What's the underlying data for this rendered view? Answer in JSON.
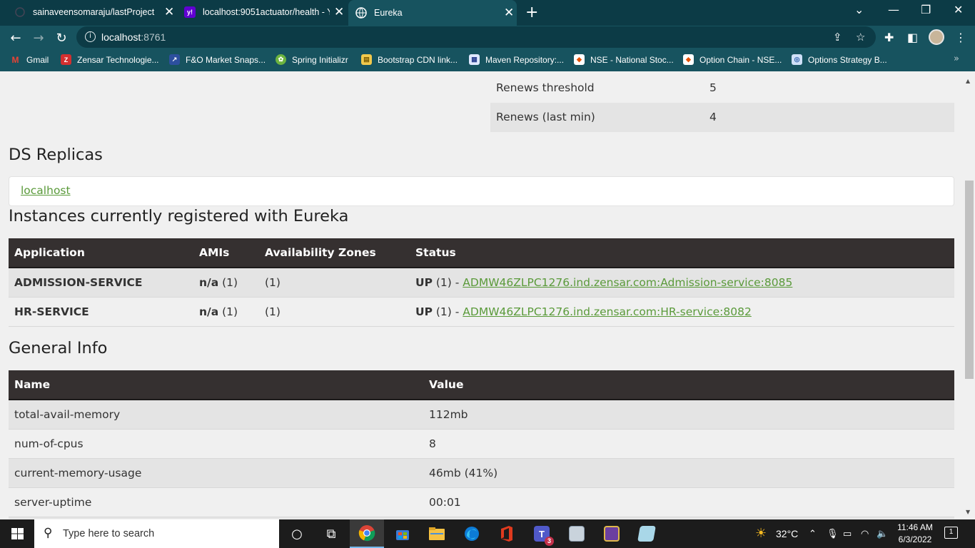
{
  "browser": {
    "tabs": [
      {
        "title": "sainaveensomaraju/lastProject",
        "active": false
      },
      {
        "title": "localhost:9051actuator/health - Y",
        "active": false
      },
      {
        "title": "Eureka",
        "active": true
      }
    ],
    "new_tab_label": "+",
    "url_host": "localhost",
    "url_port": ":8761",
    "bookmarks": [
      "Gmail",
      "Zensar Technologie...",
      "F&O Market Snaps...",
      "Spring Initializr",
      "Bootstrap CDN link...",
      "Maven Repository:...",
      "NSE - National Stoc...",
      "Option Chain - NSE...",
      "Options Strategy B..."
    ]
  },
  "stats": {
    "rows": [
      {
        "label": "Renews threshold",
        "value": "5"
      },
      {
        "label": "Renews (last min)",
        "value": "4"
      }
    ]
  },
  "replicas": {
    "heading": "DS Replicas",
    "link": "localhost"
  },
  "instances": {
    "heading": "Instances currently registered with Eureka",
    "columns": [
      "Application",
      "AMIs",
      "Availability Zones",
      "Status"
    ],
    "rows": [
      {
        "application": "ADMISSION-SERVICE",
        "amis_bold": "n/a",
        "amis_count": " (1)",
        "zones": "(1)",
        "status_bold": "UP",
        "status_count": " (1) - ",
        "link": "ADMW46ZLPC1276.ind.zensar.com:Admission-service:8085"
      },
      {
        "application": "HR-SERVICE",
        "amis_bold": "n/a",
        "amis_count": " (1)",
        "zones": "(1)",
        "status_bold": "UP",
        "status_count": " (1) - ",
        "link": "ADMW46ZLPC1276.ind.zensar.com:HR-service:8082"
      }
    ]
  },
  "general_info": {
    "heading": "General Info",
    "columns": [
      "Name",
      "Value"
    ],
    "rows": [
      {
        "name": "total-avail-memory",
        "value": "112mb"
      },
      {
        "name": "num-of-cpus",
        "value": "8"
      },
      {
        "name": "current-memory-usage",
        "value": "46mb (41%)"
      },
      {
        "name": "server-uptime",
        "value": "00:01"
      }
    ]
  },
  "taskbar": {
    "search_placeholder": "Type here to search",
    "weather": "32°C",
    "time": "11:46 AM",
    "date": "6/3/2022",
    "teams_badge": "3",
    "notification_count": "1"
  },
  "colors": {
    "chrome_dark": "#0c3b46",
    "chrome": "#17535f",
    "table_header": "#353030",
    "link_green": "#5a9a3a"
  }
}
